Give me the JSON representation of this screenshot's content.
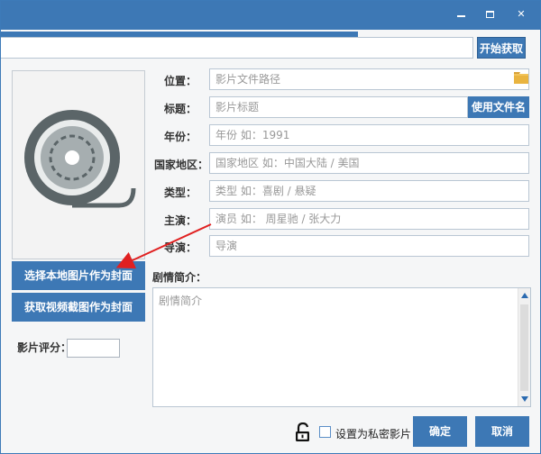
{
  "window": {
    "controls": {
      "minimize_icon": "minimize-icon",
      "maximize_icon": "maximize-icon",
      "close_icon": "close-icon",
      "close_glyph": "✕"
    }
  },
  "toolbar": {
    "fetch_label": "开始获取"
  },
  "cover": {
    "local_cover_label": "选择本地图片作为封面",
    "video_cover_label": "获取视频截图作为封面",
    "placeholder_icon": "film-reel-icon"
  },
  "rating": {
    "label": "影片评分："
  },
  "form": {
    "location": {
      "label": "位置：",
      "placeholder": "影片文件路径"
    },
    "title": {
      "label": "标题：",
      "placeholder": "影片标题"
    },
    "year": {
      "label": "年份：",
      "placeholder": "年份 如：1991"
    },
    "region": {
      "label": "国家地区：",
      "placeholder": "国家地区 如：中国大陆 / 美国"
    },
    "genre": {
      "label": "类型：",
      "placeholder": "类型  如：喜剧 / 悬疑"
    },
    "cast": {
      "label": "主演：",
      "placeholder": "演员 如： 周星驰 / 张大力"
    },
    "director": {
      "label": "导演：",
      "placeholder": "导演"
    },
    "use_filename_label": "使用文件名"
  },
  "synopsis": {
    "label": "剧情简介：",
    "placeholder": "剧情简介"
  },
  "footer": {
    "private_label": "设置为私密影片",
    "ok_label": "确定",
    "cancel_label": "取消"
  },
  "colors": {
    "accent": "#3d78b5",
    "arrow": "#e02020",
    "reel": "#5b6568"
  }
}
